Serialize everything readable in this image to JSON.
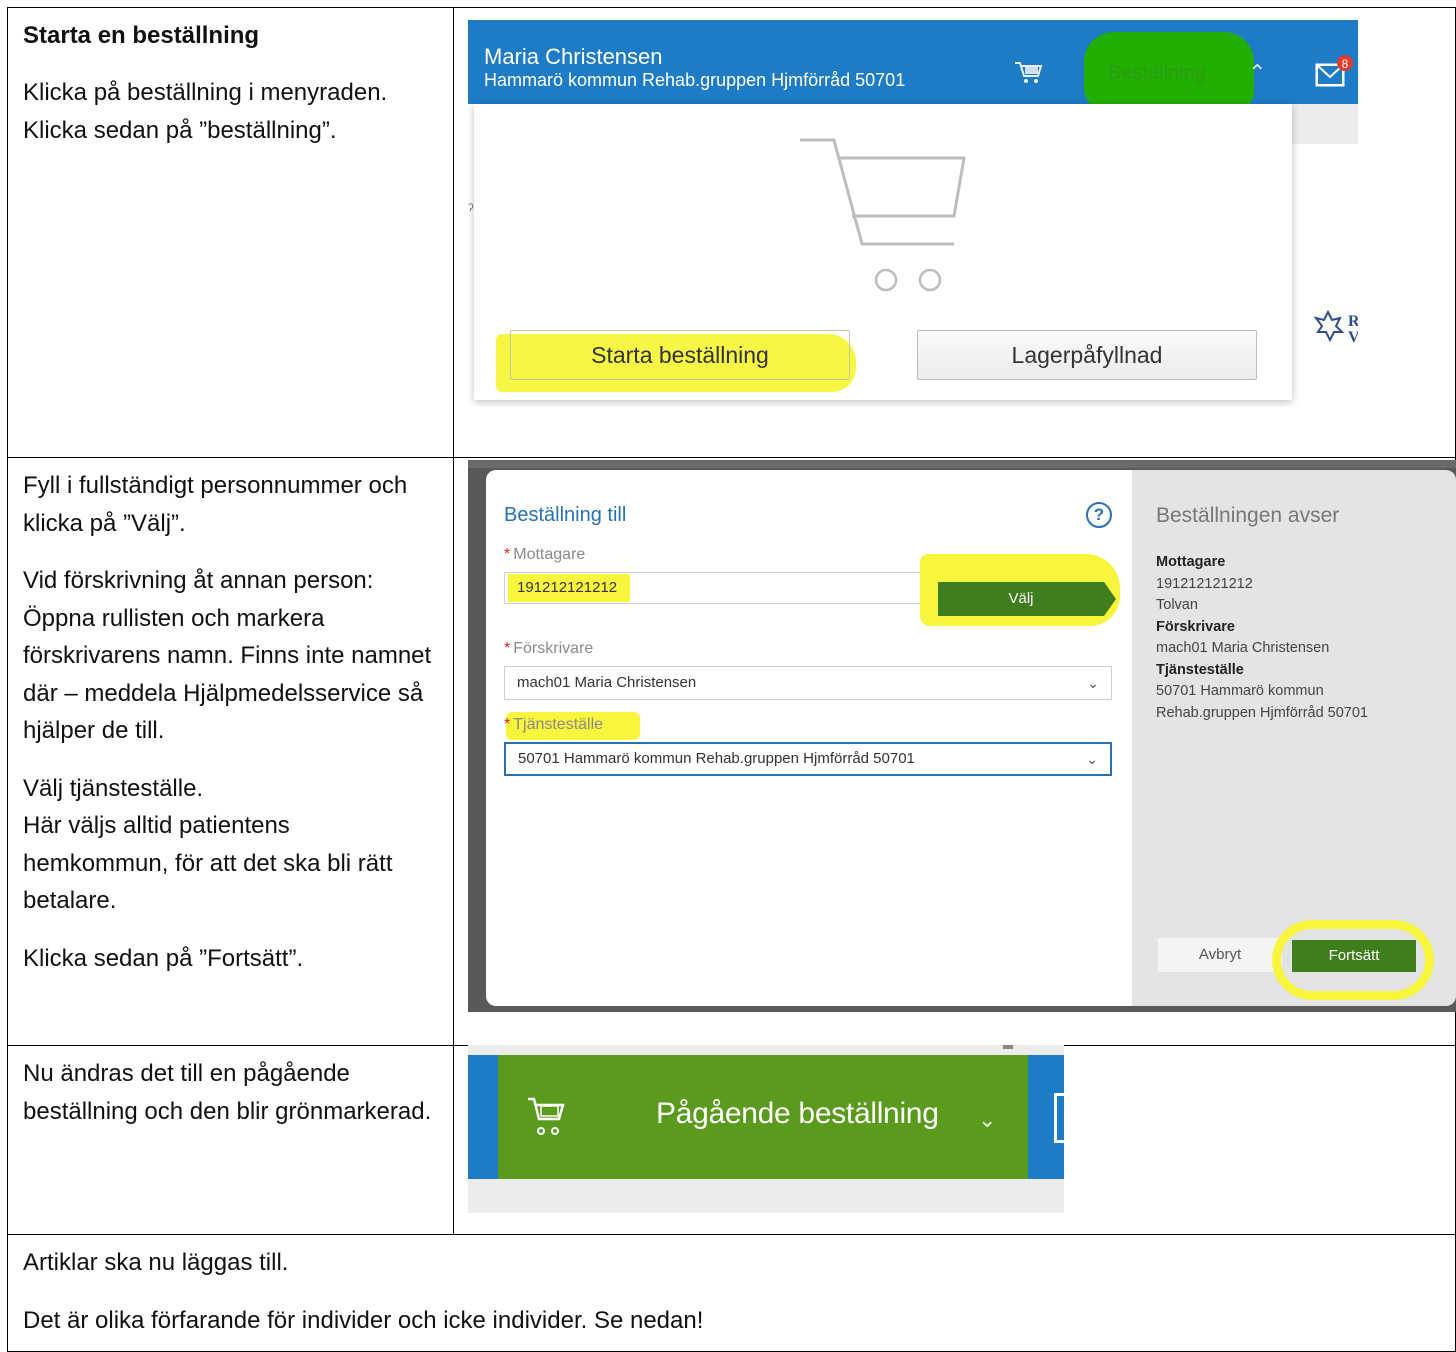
{
  "row1": {
    "heading": "Starta en beställning",
    "paragraph1": "Klicka på beställning i menyraden. Klicka sedan på ”beställning”.",
    "screenshot": {
      "user_name": "Maria Christensen",
      "org": "Hammarö kommun Rehab.gruppen Hjmförråd 50701",
      "menu_item": "Beställning",
      "mail_badge": "8",
      "btn_start": "Starta beställning",
      "btn_lager": "Lagerpåfyllnad"
    }
  },
  "row2": {
    "p1": "Fyll i fullständigt personnummer och klicka på ”Välj”.",
    "p2": "Vid förskrivning åt annan person: Öppna rullisten och markera förskrivarens namn. Finns inte namnet där – meddela Hjälpmedelsservice så hjälper de till.",
    "p3a": "Välj tjänsteställe.",
    "p3b": "Här väljs alltid patientens hemkommun, för att det ska bli rätt betalare.",
    "p4": "Klicka sedan på ”Fortsätt”.",
    "dialog": {
      "title": "Beställning till",
      "help": "?",
      "label_mottagare": "Mottagare",
      "mottagare_value": "191212121212",
      "btn_valj": "Välj",
      "label_forskrivare": "Förskrivare",
      "forskrivare_value": "mach01 Maria Christensen",
      "label_tjanstestalle": "Tjänsteställe",
      "tjanstestalle_value": "50701 Hammarö kommun Rehab.gruppen Hjmförråd 50701",
      "side_title": "Beställningen avser",
      "side_mottagare_label": "Mottagare",
      "side_mottagare_id": "191212121212",
      "side_mottagare_name": "Tolvan",
      "side_forskrivare_label": "Förskrivare",
      "side_forskrivare_value": "mach01 Maria Christensen",
      "side_tjanste_label": "Tjänsteställe",
      "side_tjanste_line1": "50701 Hammarö kommun",
      "side_tjanste_line2": "Rehab.gruppen Hjmförråd 50701",
      "btn_avbryt": "Avbryt",
      "btn_fortsatt": "Fortsätt"
    }
  },
  "row3": {
    "text": "Nu ändras det till en pågående beställning och den blir grönmarkerad.",
    "banner": "Pågående beställning"
  },
  "row4": {
    "p1": "Artiklar ska nu läggas till.",
    "p2": "Det är olika förfarande för individer och icke individer. Se nedan!"
  },
  "colors": {
    "header_blue": "#1e7bc6",
    "button_green": "#3e7e1d",
    "highlight_yellow": "#f7f53c",
    "banner_green": "#5a9a1c"
  }
}
